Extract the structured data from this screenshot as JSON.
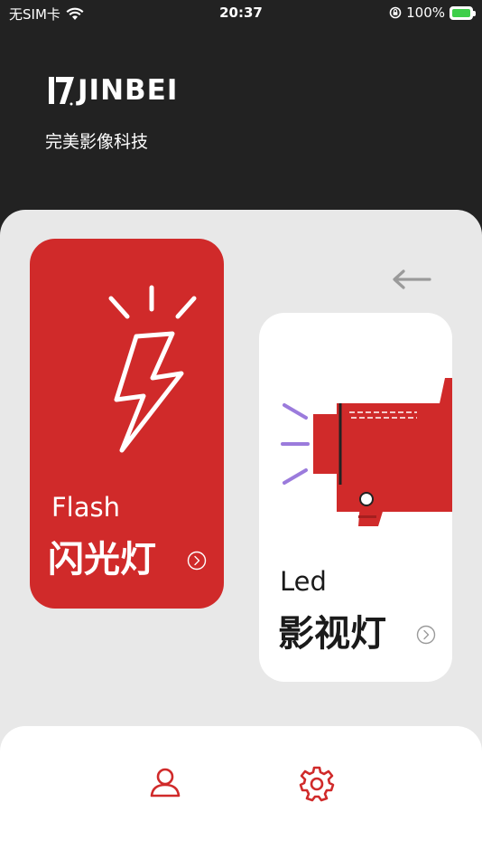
{
  "status_bar": {
    "carrier": "无SIM卡",
    "time": "20:37",
    "battery": "100%"
  },
  "brand": {
    "name": "JINBEI",
    "slogan": "完美影像科技"
  },
  "cards": {
    "flash": {
      "en": "Flash",
      "cn": "闪光灯"
    },
    "led": {
      "en": "Led",
      "cn": "影视灯"
    }
  },
  "colors": {
    "accent": "#d02a2a",
    "header_bg": "#222222",
    "panel_bg": "#e8e8e8",
    "led_purple": "#9b7bdc"
  },
  "icons": {
    "wifi": "wifi-icon",
    "rotation_lock": "rotation-lock-icon",
    "battery": "battery-icon",
    "back": "arrow-left-icon",
    "flash": "lightning-icon",
    "led": "video-light-icon",
    "go": "chevron-right-circle-icon",
    "user": "user-icon",
    "settings": "gear-icon"
  }
}
